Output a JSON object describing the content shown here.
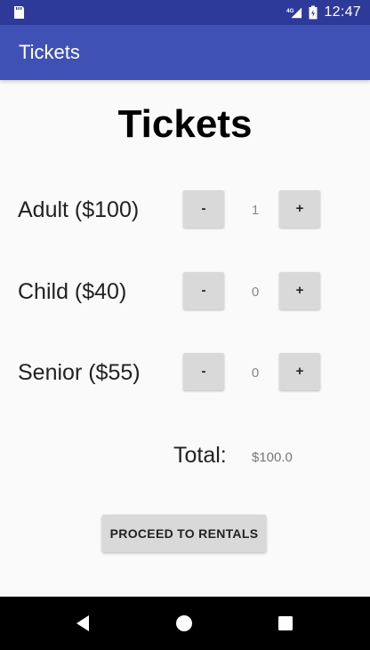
{
  "status_bar": {
    "time": "12:47",
    "network_label": "4G",
    "colors": {
      "background": "#2e3a99",
      "foreground": "#ffffff"
    },
    "icons": [
      "sd-card-icon",
      "signal-icon",
      "battery-icon"
    ]
  },
  "app_bar": {
    "title": "Tickets",
    "color": "#3f51b5"
  },
  "main": {
    "heading": "Tickets",
    "rows": [
      {
        "label": "Adult ($100)",
        "minus": "-",
        "count": "1",
        "plus": "+"
      },
      {
        "label": "Child ($40)",
        "minus": "-",
        "count": "0",
        "plus": "+"
      },
      {
        "label": "Senior ($55)",
        "minus": "-",
        "count": "0",
        "plus": "+"
      }
    ],
    "total_label": "Total:",
    "total_value": "$100.0",
    "proceed_button": "PROCEED TO RENTALS"
  },
  "nav_bar": {
    "icons": [
      "back-icon",
      "home-icon",
      "recents-icon"
    ]
  }
}
